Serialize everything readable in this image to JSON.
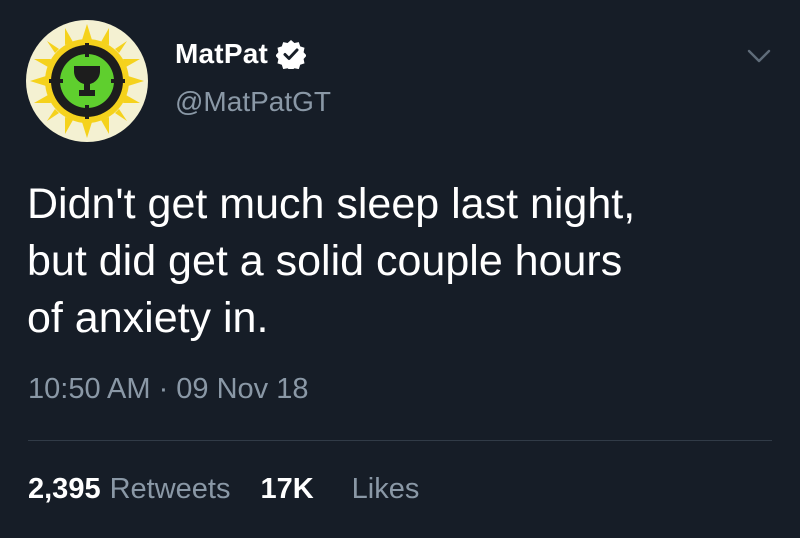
{
  "user": {
    "display_name": "MatPat",
    "handle": "@MatPatGT",
    "verified": true,
    "avatar_icon": "game-theory-logo-icon",
    "verified_icon": "verified-badge-icon"
  },
  "menu": {
    "icon": "chevron-down-icon"
  },
  "tweet": {
    "lines": [
      "Didn't get much sleep last night,",
      "but did get a solid couple hours",
      "of anxiety in."
    ],
    "timestamp": "10:50 AM · 09 Nov 18"
  },
  "stats": {
    "retweets_count": "2,395",
    "retweets_label": "Retweets",
    "likes_count": "17K",
    "likes_label": "Likes"
  },
  "colors": {
    "background": "#161d27",
    "primary_text": "#ffffff",
    "secondary_text": "#8a98a6",
    "divider": "#313b47"
  }
}
